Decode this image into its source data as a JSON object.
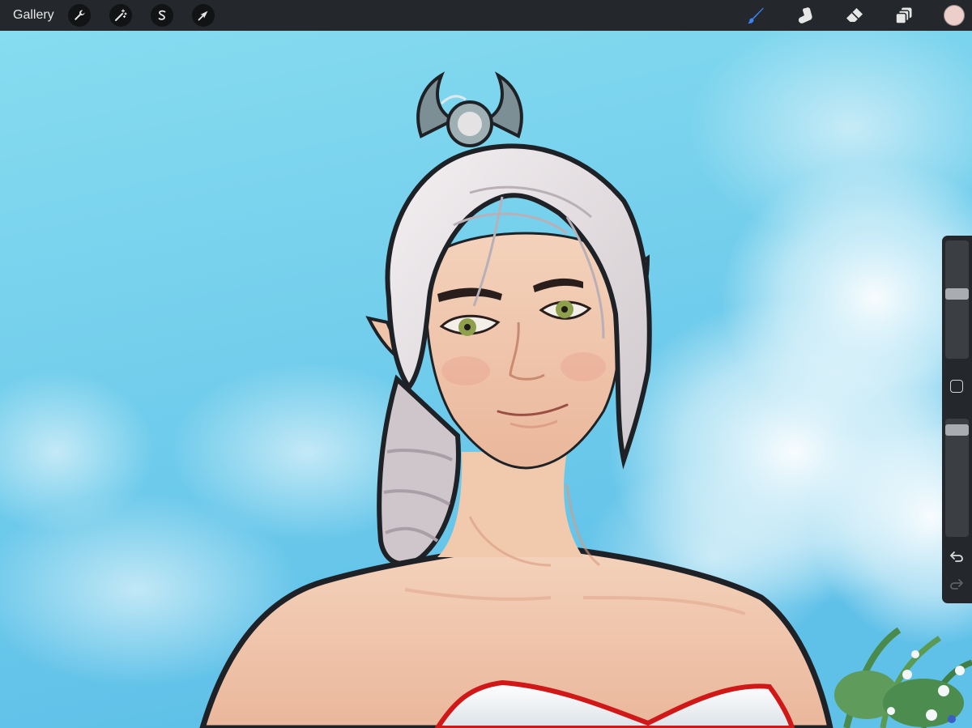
{
  "toolbar": {
    "gallery_label": "Gallery",
    "left_tools": [
      {
        "name": "actions",
        "icon": "wrench-icon"
      },
      {
        "name": "adjustments",
        "icon": "magic-wand-icon"
      },
      {
        "name": "selection",
        "icon": "selection-s-icon"
      },
      {
        "name": "transform",
        "icon": "arrow-cursor-icon"
      }
    ],
    "right_tools": [
      {
        "name": "brush",
        "icon": "brush-icon",
        "active": true
      },
      {
        "name": "smudge",
        "icon": "smudge-finger-icon",
        "active": false
      },
      {
        "name": "eraser",
        "icon": "eraser-icon",
        "active": false
      },
      {
        "name": "layers",
        "icon": "layers-icon",
        "active": false
      }
    ],
    "current_color": "#eccfcb"
  },
  "sidebar": {
    "brush_size_level": 0.55,
    "opacity_level": 0.95,
    "modify_icon": "square-modify-icon",
    "undo_icon": "undo-arrow-icon",
    "redo_icon": "redo-arrow-icon"
  },
  "colors": {
    "toolbar_bg": "#24272b",
    "active_tool": "#3c82f0",
    "inactive_tool": "#e6e6e6",
    "sky": "#8ad8ee"
  }
}
